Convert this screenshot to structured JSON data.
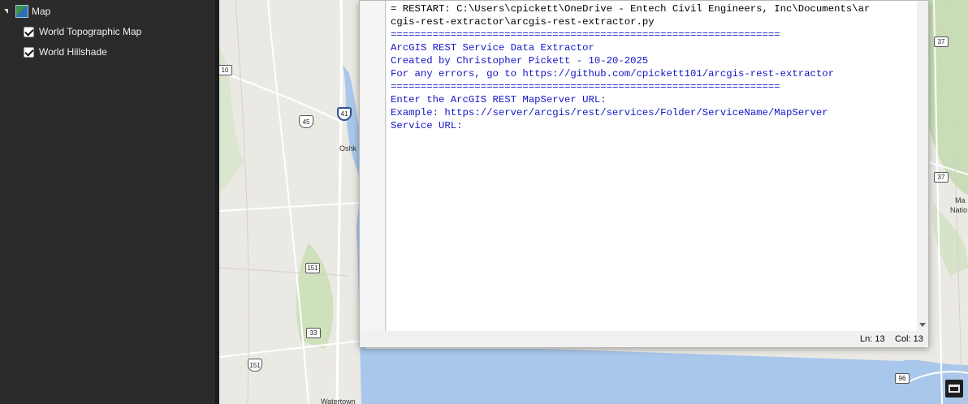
{
  "contents_pane": {
    "map_node": {
      "label": "Map",
      "icon": "map-icon"
    },
    "layers": [
      {
        "label": "World Topographic Map",
        "checked": true
      },
      {
        "label": "World Hillshade",
        "checked": true
      }
    ]
  },
  "map": {
    "colors": {
      "land": "#ebe9e4",
      "water": "#a9c7ea",
      "green": "#c8dcb6",
      "road": "#ffffff"
    },
    "shields": [
      {
        "kind": "state",
        "text": "10"
      },
      {
        "kind": "inter",
        "text": "41"
      },
      {
        "kind": "us",
        "text": "45"
      },
      {
        "kind": "state",
        "text": "151"
      },
      {
        "kind": "state",
        "text": "33"
      },
      {
        "kind": "us",
        "text": "151"
      },
      {
        "kind": "state",
        "text": "37"
      },
      {
        "kind": "state",
        "text": "37"
      },
      {
        "kind": "state",
        "text": "96"
      }
    ],
    "labels": [
      "Oshk",
      "Ma",
      "Natio",
      "Watertown"
    ]
  },
  "shell": {
    "lines": [
      {
        "text": "= RESTART: C:\\Users\\cpickett\\OneDrive - Entech Civil Engineers, Inc\\Documents\\ar",
        "color": "black"
      },
      {
        "text": "cgis-rest-extractor\\arcgis-rest-extractor.py",
        "color": "black"
      },
      {
        "text": "=================================================================",
        "color": "blue"
      },
      {
        "text": "ArcGIS REST Service Data Extractor",
        "color": "blue"
      },
      {
        "text": "Created by Christopher Pickett - 10-20-2025",
        "color": "blue"
      },
      {
        "text": "For any errors, go to https://github.com/cpickett101/arcgis-rest-extractor",
        "color": "blue"
      },
      {
        "text": "=================================================================",
        "color": "blue"
      },
      {
        "text": "",
        "color": "blue"
      },
      {
        "text": "Enter the ArcGIS REST MapServer URL:",
        "color": "blue"
      },
      {
        "text": "Example: https://server/arcgis/rest/services/Folder/ServiceName/MapServer",
        "color": "blue"
      },
      {
        "text": "Service URL:",
        "color": "blue"
      }
    ],
    "status": {
      "line": "Ln: 13",
      "col": "Col: 13"
    }
  }
}
